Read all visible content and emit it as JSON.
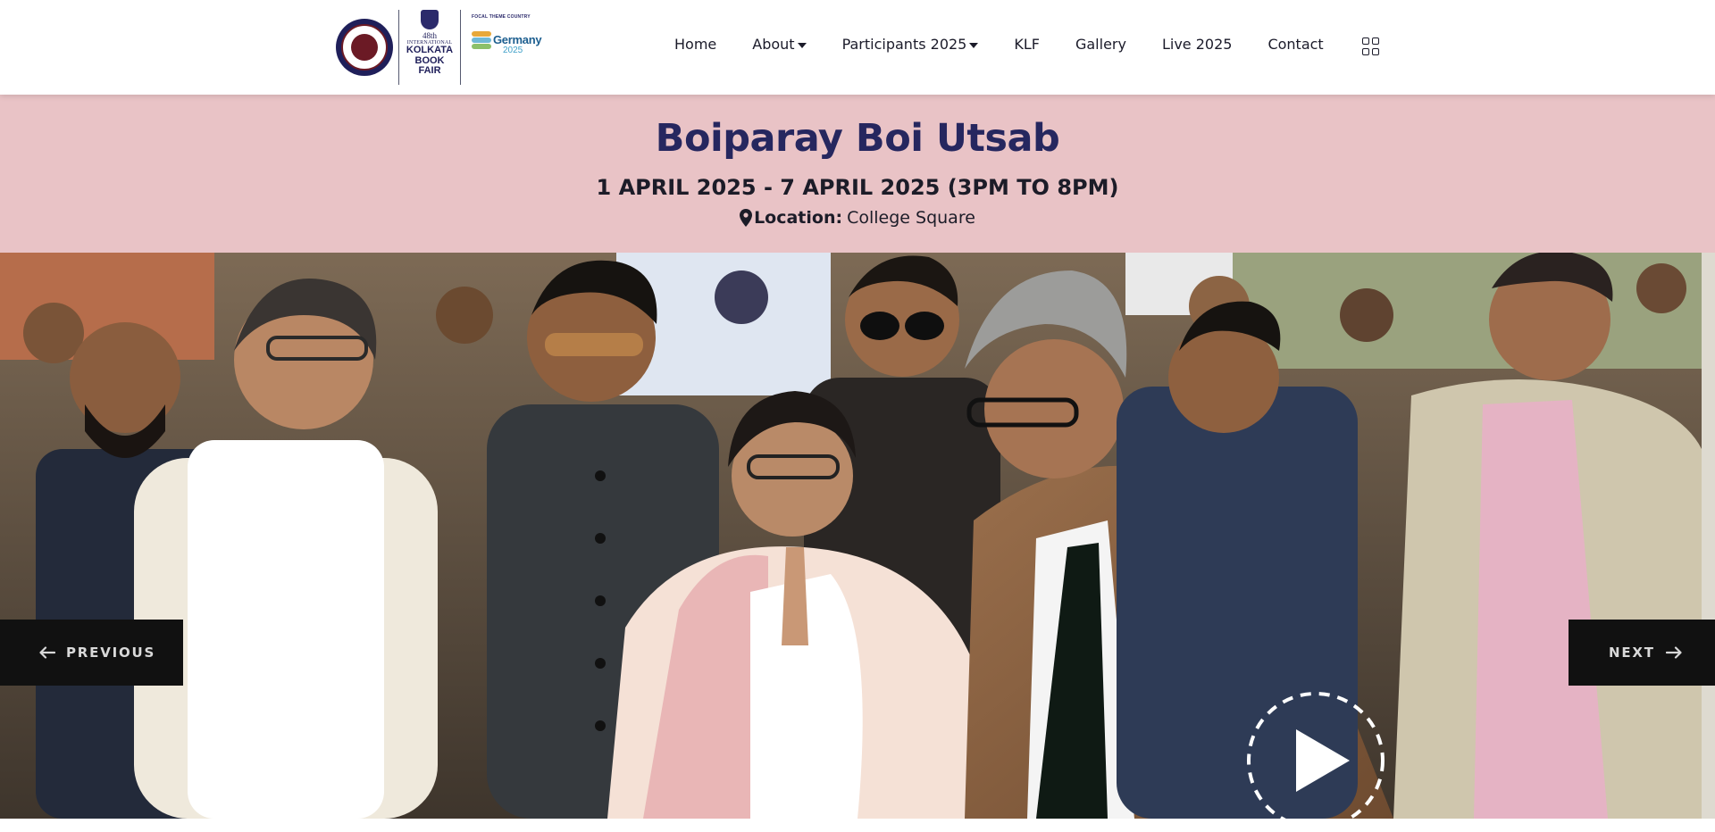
{
  "header": {
    "logos": {
      "institution_seal": "publishers-guild-seal",
      "fair_logo": {
        "edition": "48th",
        "international": "INTERNATIONAL",
        "name_lines": [
          "KOLKATA",
          "BOOK",
          "FAIR"
        ]
      },
      "focal_theme": {
        "caption": "FOCAL THEME COUNTRY",
        "country": "Germany",
        "year": "2025"
      }
    },
    "nav": [
      {
        "label": "Home",
        "has_dropdown": false
      },
      {
        "label": "About",
        "has_dropdown": true
      },
      {
        "label": "Participants 2025",
        "has_dropdown": true
      },
      {
        "label": "KLF",
        "has_dropdown": false
      },
      {
        "label": "Gallery",
        "has_dropdown": false
      },
      {
        "label": "Live 2025",
        "has_dropdown": false
      },
      {
        "label": "Contact",
        "has_dropdown": false
      }
    ],
    "menu_icon": "grid-menu-icon"
  },
  "banner": {
    "title": "Boiparay Boi Utsab",
    "dates": "1 APRIL 2025 - 7 APRIL 2025 (3PM TO 8PM)",
    "location_label": "Location:",
    "location_value": "College Square",
    "background_color": "#e9c3c6",
    "title_color": "#26275f"
  },
  "slider": {
    "previous_label": "PREVIOUS",
    "next_label": "NEXT",
    "play_icon": "play-icon"
  }
}
